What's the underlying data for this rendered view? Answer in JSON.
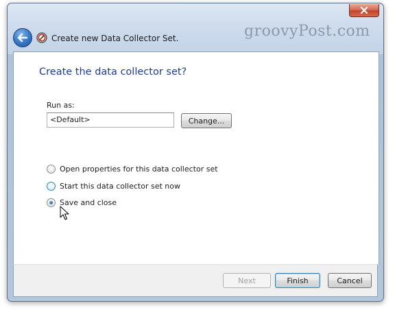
{
  "window": {
    "title": "Create new Data Collector Set.",
    "watermark": "groovyPost.com"
  },
  "page": {
    "heading": "Create the data collector set?",
    "run_as_label": "Run as:",
    "run_as_value": "<Default>",
    "change_button": "Change..."
  },
  "options": [
    {
      "label": "Open properties for this data collector set",
      "selected": false
    },
    {
      "label": "Start this data collector set now",
      "selected": false
    },
    {
      "label": "Save and close",
      "selected": true
    }
  ],
  "footer": {
    "next_button": "Next",
    "finish_button": "Finish",
    "cancel_button": "Cancel"
  },
  "icons": {
    "back": "back-arrow-icon",
    "app": "performance-monitor-icon",
    "close": "close-icon"
  },
  "colors": {
    "heading": "#1e3d8f",
    "close_button": "#c3432b",
    "back_button": "#3f7fd0"
  }
}
